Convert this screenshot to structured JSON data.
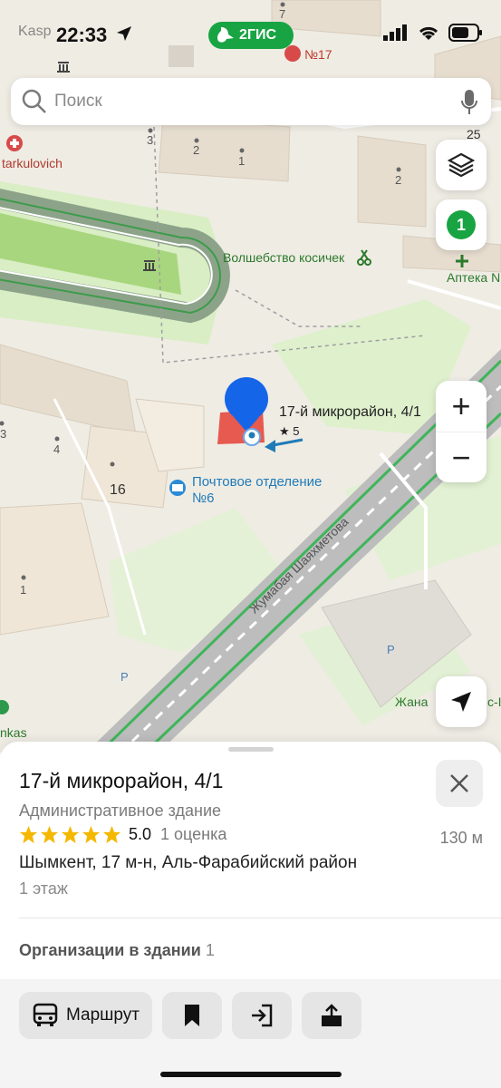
{
  "status_bar": {
    "back_label": "Kasp",
    "time": "22:33",
    "brand": "2ГИС",
    "icons": [
      "location-arrow-icon",
      "signal-icon",
      "wifi-icon",
      "battery-icon"
    ]
  },
  "search": {
    "placeholder": "Поиск"
  },
  "map": {
    "layers_icon": "layers-icon",
    "results_count": "1",
    "zoom_in": "+",
    "zoom_out": "−",
    "labels": {
      "selected_place": "17-й микрорайон, 4/1",
      "selected_rating": "★ 5",
      "post_office_line1": "Почтовое отделение",
      "post_office_line2": "№6",
      "hair_salon": "Волшебство косичек",
      "pharmacy": "Аптека N",
      "street": "Жумабая Шаяхметова",
      "poi_tl": "tarkulovich",
      "poi_top": "№17",
      "poi_br": "Жана",
      "poi_br2": "с-I",
      "poi_bl": "nkas",
      "parking1": "P",
      "parking2": "P",
      "house_numbers": [
        "3",
        "2",
        "1",
        "2",
        "25",
        "7",
        "16",
        "4",
        "1",
        "3"
      ]
    }
  },
  "sheet": {
    "title": "17-й микрорайон, 4/1",
    "category": "Административное здание",
    "rating_value": "5.0",
    "rating_count": "1 оценка",
    "stars": 5,
    "distance": "130 м",
    "address": "Шымкент, 17 м-н, Аль-Фарабийский район",
    "floors": "1 этаж",
    "orgs_label": "Организации в здании",
    "orgs_count": "1"
  },
  "actions": {
    "route_label": "Маршрут"
  },
  "colors": {
    "brand_green": "#19a443",
    "star_yellow": "#f5b800",
    "marker_blue": "#1565e8"
  }
}
